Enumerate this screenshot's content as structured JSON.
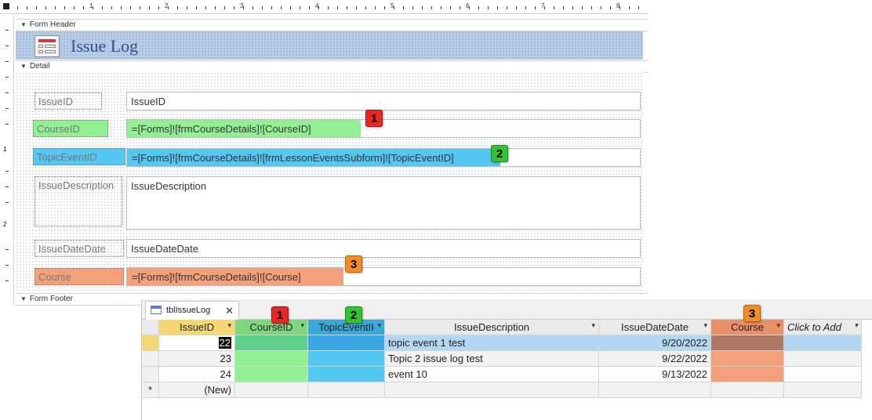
{
  "design": {
    "ruler_numbers": [
      "1",
      "2",
      "3",
      "4",
      "5",
      "6",
      "7",
      "8"
    ],
    "ruler_left_numbers": [
      "1",
      "2"
    ],
    "sections": {
      "form_header": "Form Header",
      "detail": "Detail",
      "form_footer": "Form Footer"
    },
    "title": "Issue Log",
    "fields": [
      {
        "label": "IssueID",
        "control": "IssueID"
      },
      {
        "label": "CourseID",
        "control": "=[Forms]![frmCourseDetails]![CourseID]"
      },
      {
        "label": "TopicEventID",
        "control": "=[Forms]![frmCourseDetails]![frmLessonEventsSubform]![TopicEventID]"
      },
      {
        "label": "IssueDescription",
        "control": "IssueDescription"
      },
      {
        "label": "IssueDateDate",
        "control": "IssueDateDate"
      },
      {
        "label": "Course",
        "control": "=[Forms]![frmCourseDetails]![Course]"
      }
    ],
    "badges": [
      "1",
      "2",
      "3"
    ]
  },
  "datasheet": {
    "tab_title": "tblIssueLog",
    "close_glyph": "✕",
    "columns": [
      "IssueID",
      "CourseID",
      "TopicEventII",
      "IssueDescription",
      "IssueDateDate",
      "Course",
      "Click to Add"
    ],
    "rows": [
      {
        "IssueID": "22",
        "IssueDescription": "topic event 1 test",
        "IssueDateDate": "9/20/2022"
      },
      {
        "IssueID": "23",
        "IssueDescription": "Topic 2 issue log test",
        "IssueDateDate": "9/22/2022"
      },
      {
        "IssueID": "24",
        "IssueDescription": "event 10",
        "IssueDateDate": "9/13/2022"
      }
    ],
    "new_row_label": "(New)",
    "new_row_marker": "*",
    "badges": [
      "1",
      "2",
      "3"
    ]
  },
  "colors": {
    "green": "#93ef93",
    "blue": "#54c7f2",
    "orange": "#f4a07a",
    "header_band": "#b9cde8"
  }
}
